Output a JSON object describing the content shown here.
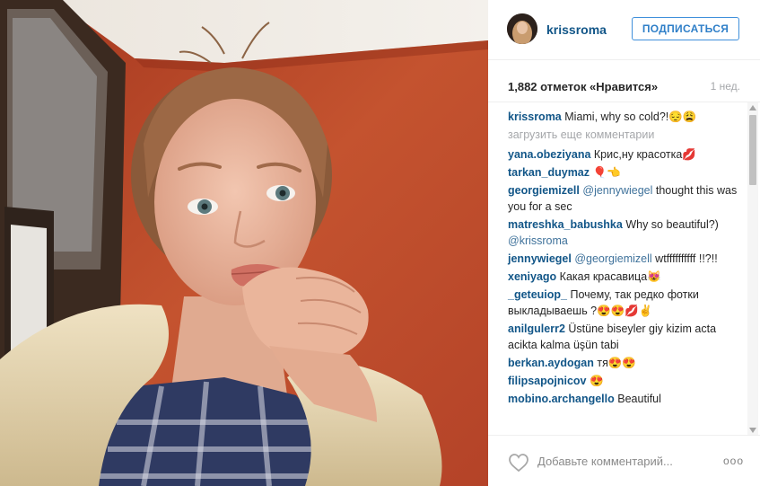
{
  "post": {
    "username": "krissroma",
    "follow_label": "ПОДПИСАТЬСЯ",
    "likes_text": "1,882 отметок «Нравится»",
    "time": "1 нед.",
    "load_more": "загрузить еще комментарии",
    "comment_placeholder": "Добавьте комментарий...",
    "more_label": "ooo"
  },
  "caption": {
    "user": "krissroma",
    "text": "Miami, why so cold?!😔😩"
  },
  "comments": [
    {
      "user": "yana.obeziyana",
      "text": "Крис,ну красотка💋"
    },
    {
      "user": "tarkan_duymaz",
      "text": "🎈👈"
    },
    {
      "user": "georgiemizell",
      "mention": "@jennywiegel",
      "text": "thought this was you for a sec"
    },
    {
      "user": "matreshka_babushka",
      "text": "Why so beautiful?)",
      "mention_after": "@krissroma"
    },
    {
      "user": "jennywiegel",
      "mention": "@georgiemizell",
      "text": "wtffffffffff !!?!!"
    },
    {
      "user": "xeniyago",
      "text": "Какая красавица😻"
    },
    {
      "user": "_geteuiop_",
      "text": "Почему, так редко фотки выкладываешь ?😍😍💋✌"
    },
    {
      "user": "anilgulerr2",
      "text": "Üstüne biseyler giy kizim acta acikta kalma üşün tabi"
    },
    {
      "user": "berkan.aydogan",
      "text": "тя😍😍"
    },
    {
      "user": "filipsapojnicov",
      "text": "😍"
    },
    {
      "user": "mobino.archangello",
      "text": "Beautiful"
    }
  ],
  "colors": {
    "username": "#125688",
    "follow_border": "#4090db",
    "secondary_text": "#a5a7aa",
    "wall": "#b8482c"
  },
  "icons": {
    "like": "heart-outline-icon",
    "more": "more-options-icon"
  }
}
